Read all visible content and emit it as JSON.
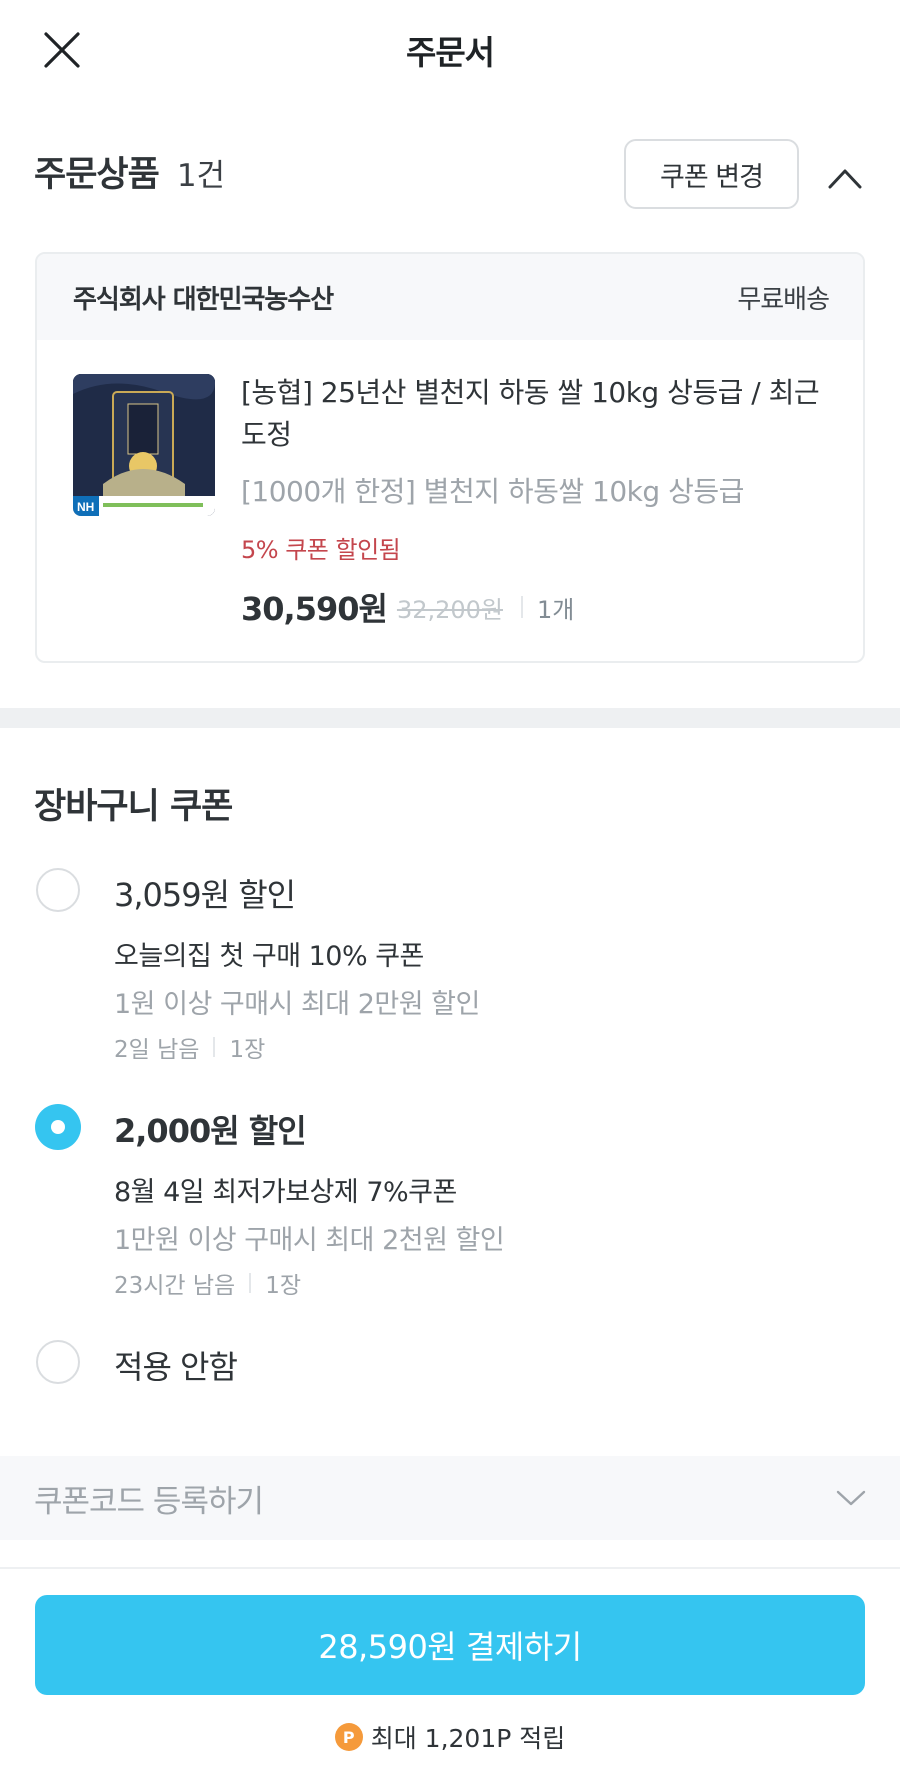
{
  "header": {
    "title": "주문서",
    "close_icon": "close-icon"
  },
  "order_products": {
    "title": "주문상품",
    "count": "1건",
    "coupon_change_label": "쿠폰 변경",
    "collapse_icon": "chevron-up-icon"
  },
  "product_card": {
    "seller": "주식회사 대한민국농수산",
    "shipping": "무료배송",
    "name": "[농협] 25년산 별천지 하동 쌀 10kg 상등급 / 최근 도정",
    "option": "[1000개 한정] 별천지 하동쌀 10kg 상등급",
    "discount_note": "5% 쿠폰 할인됨",
    "price": "30,590원",
    "original_price": "32,200원",
    "quantity": "1개",
    "thumbnail_badge": "NH"
  },
  "cart_coupon": {
    "title": "장바구니 쿠폰",
    "options": [
      {
        "amount": "3,059원 할인",
        "name": "오늘의집 첫 구매 10% 쿠폰",
        "condition": "1원 이상 구매시 최대 2만원 할인",
        "remaining": "2일 남음",
        "count": "1장",
        "selected": false
      },
      {
        "amount": "2,000원 할인",
        "name": "8월 4일 최저가보상제 7%쿠폰",
        "condition": "1만원 이상 구매시 최대 2천원 할인",
        "remaining": "23시간 남음",
        "count": "1장",
        "selected": true
      }
    ],
    "none_label": "적용 안함"
  },
  "coupon_code": {
    "label": "쿠폰코드 등록하기",
    "icon": "chevron-down-icon"
  },
  "checkout": {
    "pay_label": "28,590원 결제하기",
    "points_badge": "P",
    "points_text": "최대 1,201P 적립"
  },
  "colors": {
    "accent": "#35c5f0",
    "discount_red": "#c4464d",
    "points_orange": "#f59a3b"
  }
}
